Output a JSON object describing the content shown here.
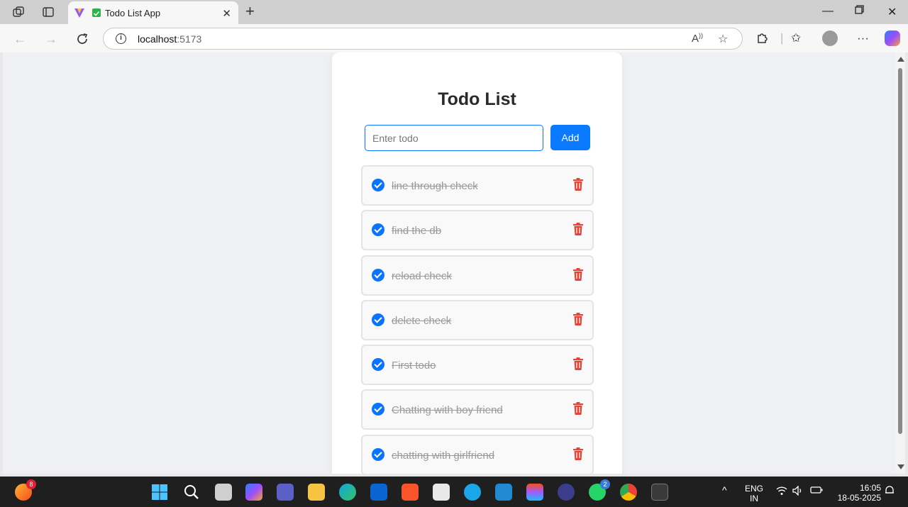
{
  "browser": {
    "tab_title": "Todo List App",
    "new_tab": "+",
    "url_host": "localhost",
    "url_port": ":5173"
  },
  "app": {
    "title": "Todo List",
    "input_placeholder": "Enter todo",
    "add_label": "Add",
    "accent_color": "#0a74ff",
    "delete_color": "#e2463a",
    "todos": [
      {
        "text": "line through check",
        "completed": true
      },
      {
        "text": "find the db",
        "completed": true
      },
      {
        "text": "reload check",
        "completed": true
      },
      {
        "text": "delete check",
        "completed": true
      },
      {
        "text": "First todo",
        "completed": true
      },
      {
        "text": "Chatting with boy friend",
        "completed": true
      },
      {
        "text": "chatting with girlfriend",
        "completed": true
      }
    ]
  },
  "taskbar": {
    "weather_badge": "8",
    "whatsapp_badge": "2",
    "language": "ENG",
    "region": "IN",
    "time": "16:05",
    "date": "18-05-2025"
  }
}
